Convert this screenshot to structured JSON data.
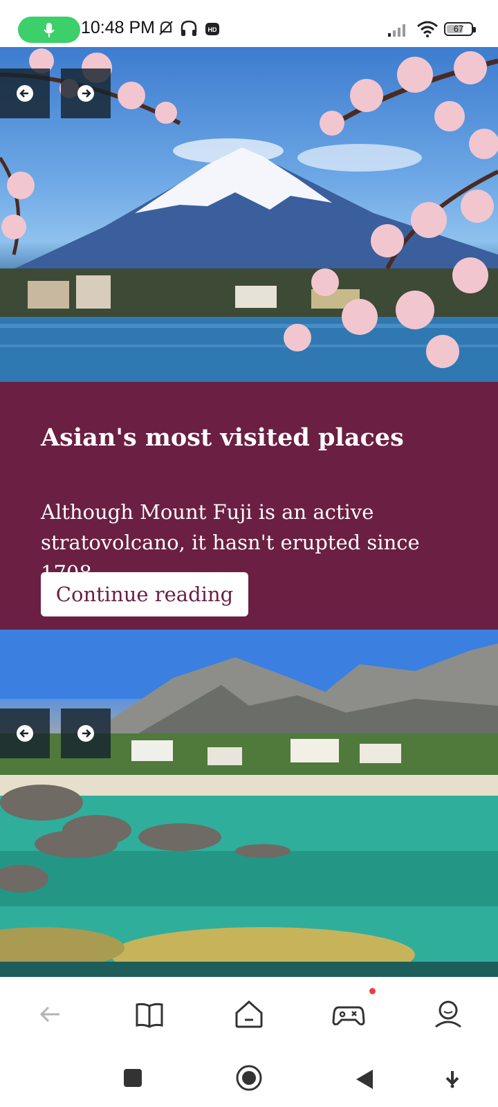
{
  "status_bar": {
    "time": "10:48 PM",
    "battery": "67",
    "battery_level": 0.67,
    "icons": [
      "mic-icon",
      "bell-off-icon",
      "headphones-icon",
      "hd-icon",
      "signal-icon",
      "wifi-icon",
      "battery-icon"
    ]
  },
  "carousel": {
    "prev_icon": "arrow-left-circle-icon",
    "next_icon": "arrow-right-circle-icon"
  },
  "card": {
    "title": "Asian's most visited places",
    "text": "Although Mount Fuji is an active stratovolcano, it hasn't erupted since 1708.",
    "button_label": "Continue reading",
    "background_color": "#6b1f43"
  },
  "app_nav": {
    "items": [
      "back-icon",
      "book-icon",
      "home-icon",
      "gamepad-icon",
      "profile-icon"
    ],
    "badge_color": "#ef3b3b"
  },
  "system_nav": {
    "items": [
      "recents-square-icon",
      "home-circle-icon",
      "back-triangle-icon",
      "download-arrow-icon"
    ]
  }
}
